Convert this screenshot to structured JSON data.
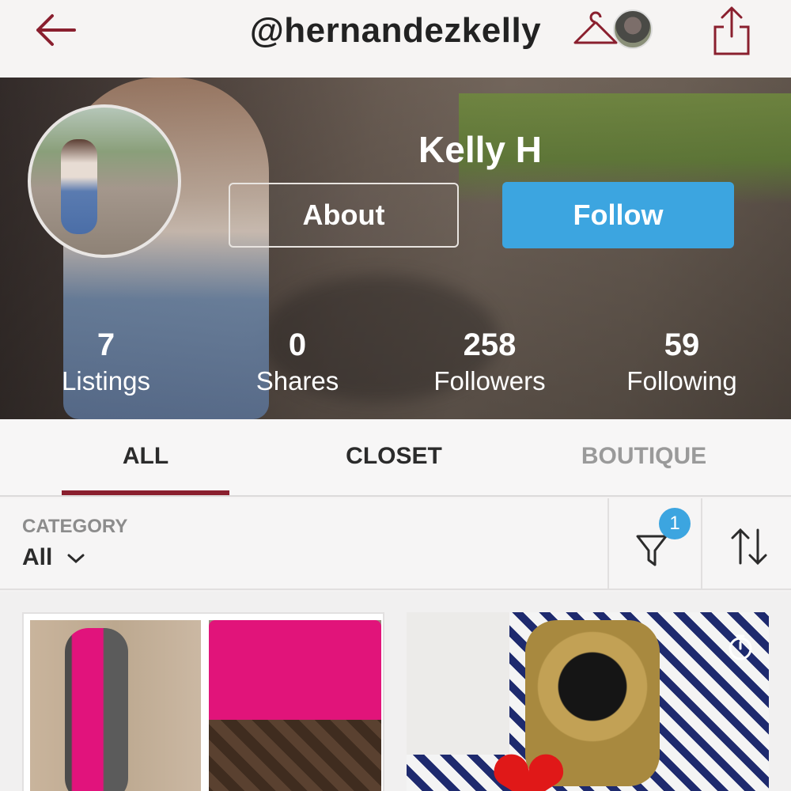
{
  "header": {
    "username": "@hernandezkelly",
    "icons": [
      "back-arrow-icon",
      "hanger-icon",
      "share-icon"
    ]
  },
  "profile": {
    "display_name": "Kelly H",
    "about_label": "About",
    "follow_label": "Follow",
    "stats": [
      {
        "value": "7",
        "label": "Listings"
      },
      {
        "value": "0",
        "label": "Shares"
      },
      {
        "value": "258",
        "label": "Followers"
      },
      {
        "value": "59",
        "label": "Following"
      }
    ]
  },
  "tabs": [
    {
      "label": "ALL",
      "active": true
    },
    {
      "label": "CLOSET",
      "active": false
    },
    {
      "label": "BOUTIQUE",
      "active": false
    }
  ],
  "filters": {
    "category_label": "CATEGORY",
    "category_value": "All",
    "filter_count": "1"
  },
  "colors": {
    "accent_red": "#8a1f2e",
    "follow_blue": "#3ca5e0"
  }
}
